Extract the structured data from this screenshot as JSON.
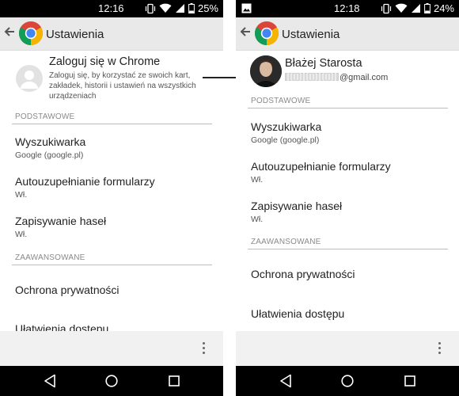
{
  "left": {
    "status": {
      "time": "12:16",
      "battery": "25%"
    },
    "appbar": {
      "title": "Ustawienia"
    },
    "signin": {
      "title": "Zaloguj się w Chrome",
      "description": "Zaloguj się, by korzystać ze swoich kart, zakładek, historii i ustawień na wszystkich urządzeniach"
    },
    "sections": {
      "basic": "PODSTAWOWE",
      "advanced": "ZAAWANSOWANE"
    },
    "items": [
      {
        "title": "Wyszukiwarka",
        "subtitle": "Google (google.pl)"
      },
      {
        "title": "Autouzupełnianie formularzy",
        "subtitle": "Wł."
      },
      {
        "title": "Zapisywanie haseł",
        "subtitle": "Wł."
      },
      {
        "title": "Ochrona prywatności",
        "subtitle": ""
      },
      {
        "title": "Ułatwienia dostępu",
        "subtitle": ""
      }
    ]
  },
  "right": {
    "status": {
      "time": "12:18",
      "battery": "24%"
    },
    "appbar": {
      "title": "Ustawienia"
    },
    "account": {
      "name": "Błażej Starosta",
      "email_suffix": "@gmail.com"
    },
    "sections": {
      "basic": "PODSTAWOWE",
      "advanced": "ZAAWANSOWANE"
    },
    "items": [
      {
        "title": "Wyszukiwarka",
        "subtitle": "Google (google.pl)"
      },
      {
        "title": "Autouzupełnianie formularzy",
        "subtitle": "Wł."
      },
      {
        "title": "Zapisywanie haseł",
        "subtitle": "Wł."
      },
      {
        "title": "Ochrona prywatności",
        "subtitle": ""
      },
      {
        "title": "Ułatwienia dostępu",
        "subtitle": ""
      }
    ]
  },
  "colors": {
    "appbar": "#e9e9e9",
    "statusbar": "#000000",
    "section_text": "#8a8a8a",
    "chrome_red": "#db4437",
    "chrome_green": "#0f9d58",
    "chrome_yellow": "#f4b400",
    "chrome_blue": "#4285f4"
  },
  "icons": [
    "back-arrow-icon",
    "chrome-logo-icon",
    "vibrate-icon",
    "wifi-icon",
    "signal-icon",
    "battery-icon",
    "gallery-icon",
    "overflow-menu-icon",
    "nav-back-icon",
    "nav-home-icon",
    "nav-recents-icon",
    "default-avatar-icon",
    "transition-arrow-icon"
  ]
}
